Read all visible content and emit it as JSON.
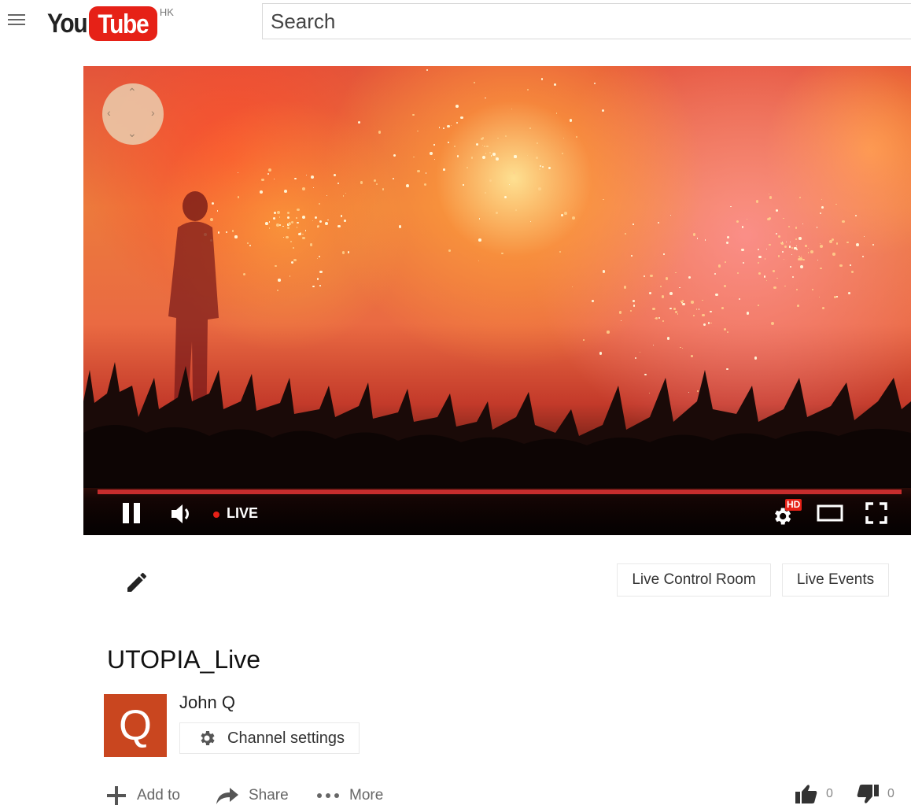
{
  "header": {
    "logo_you": "You",
    "logo_tube": "Tube",
    "logo_region": "HK",
    "search_placeholder": "Search"
  },
  "player": {
    "live_label": "LIVE",
    "hd_badge": "HD",
    "live_dot_color": "#e62117",
    "progress_color": "#c62d2d"
  },
  "toolbar": {
    "live_control_room": "Live Control Room",
    "live_events": "Live Events"
  },
  "video": {
    "title": "UTOPIA_Live"
  },
  "channel": {
    "avatar_letter": "Q",
    "avatar_color": "#c9461f",
    "name": "John Q",
    "settings_label": "Channel settings"
  },
  "actions": {
    "add_to": "Add to",
    "share": "Share",
    "more": "More",
    "like_count": "0",
    "dislike_count": "0"
  },
  "icons": {
    "menu": "hamburger-menu-icon",
    "pan": "360-pan-control-icon",
    "pause": "pause-icon",
    "volume": "volume-icon",
    "settings": "gear-icon",
    "theater": "theater-mode-icon",
    "fullscreen": "fullscreen-icon",
    "edit": "pencil-icon",
    "add": "plus-icon",
    "share": "share-arrow-icon",
    "more": "ellipsis-icon",
    "like": "thumbs-up-icon",
    "dislike": "thumbs-down-icon"
  }
}
